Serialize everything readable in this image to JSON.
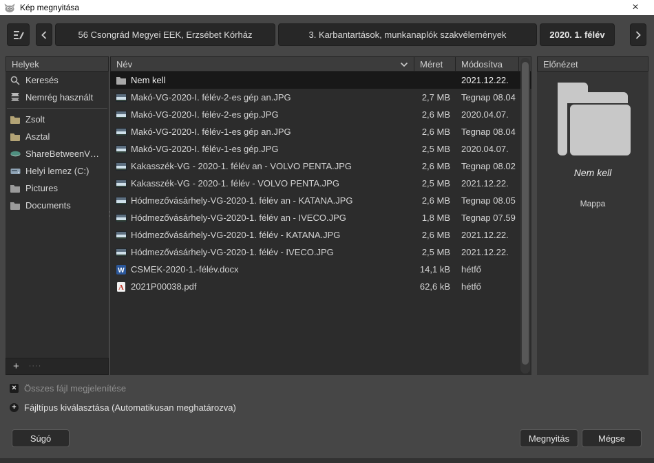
{
  "window": {
    "title": "Kép megnyitása",
    "close_glyph": "×"
  },
  "toolbar": {
    "edit_icon": "edit-filename-icon",
    "back_icon": "chevron-left-icon",
    "forward_icon": "chevron-right-icon",
    "breadcrumbs": [
      {
        "label": "56 Csongrád Megyei EEK, Erzsébet Kórház",
        "current": false
      },
      {
        "label": "3. Karbantartások, munkanaplók szakvélemények",
        "current": false
      },
      {
        "label": "2020. 1. félév",
        "current": true
      }
    ]
  },
  "places": {
    "header": "Helyek",
    "items": [
      {
        "label": "Keresés",
        "icon": "search-icon"
      },
      {
        "label": "Nemrég használt",
        "icon": "recent-icon"
      },
      {
        "label": "Zsolt",
        "icon": "folder-home-icon"
      },
      {
        "label": "Asztal",
        "icon": "folder-desktop-icon"
      },
      {
        "label": "ShareBetweenV…",
        "icon": "network-drive-icon"
      },
      {
        "label": "Helyi lemez (C:)",
        "icon": "drive-icon"
      },
      {
        "label": "Pictures",
        "icon": "folder-gray-icon"
      },
      {
        "label": "Documents",
        "icon": "folder-gray-icon"
      }
    ],
    "add_glyph": "+",
    "remove_glyph": "····"
  },
  "filelist": {
    "columns": {
      "name": "Név",
      "size": "Méret",
      "modified": "Módosítva"
    },
    "rows": [
      {
        "name": "Nem kell",
        "size": "",
        "modified": "2021.12.22.",
        "type": "folder",
        "selected": true
      },
      {
        "name": "Makó-VG-2020-I. félév-2-es gép an.JPG",
        "size": "2,7 MB",
        "modified": "Tegnap 08.04",
        "type": "image",
        "selected": false
      },
      {
        "name": "Makó-VG-2020-I. félév-2-es gép.JPG",
        "size": "2,6 MB",
        "modified": "2020.04.07.",
        "type": "image",
        "selected": false
      },
      {
        "name": "Makó-VG-2020-I. félév-1-es gép an.JPG",
        "size": "2,6 MB",
        "modified": "Tegnap 08.04",
        "type": "image",
        "selected": false
      },
      {
        "name": "Makó-VG-2020-I. félév-1-es gép.JPG",
        "size": "2,5 MB",
        "modified": "2020.04.07.",
        "type": "image",
        "selected": false
      },
      {
        "name": "Kakasszék-VG - 2020-1. félév an - VOLVO PENTA.JPG",
        "size": "2,6 MB",
        "modified": "Tegnap 08.02",
        "type": "image",
        "selected": false
      },
      {
        "name": "Kakasszék-VG - 2020-1. félév - VOLVO PENTA.JPG",
        "size": "2,5 MB",
        "modified": "2021.12.22.",
        "type": "image",
        "selected": false
      },
      {
        "name": "Hódmezővásárhely-VG-2020-1. félév an - KATANA.JPG",
        "size": "2,6 MB",
        "modified": "Tegnap 08.05",
        "type": "image",
        "selected": false
      },
      {
        "name": "Hódmezővásárhely-VG-2020-1. félév an - IVECO.JPG",
        "size": "1,8 MB",
        "modified": "Tegnap 07.59",
        "type": "image",
        "selected": false
      },
      {
        "name": "Hódmezővásárhely-VG-2020-1. félév - KATANA.JPG",
        "size": "2,6 MB",
        "modified": "2021.12.22.",
        "type": "image",
        "selected": false
      },
      {
        "name": "Hódmezővásárhely-VG-2020-1. félév - IVECO.JPG",
        "size": "2,5 MB",
        "modified": "2021.12.22.",
        "type": "image",
        "selected": false
      },
      {
        "name": "CSMEK-2020-1.-félév.docx",
        "size": "14,1 kB",
        "modified": "hétfő",
        "type": "word",
        "selected": false
      },
      {
        "name": "2021P00038.pdf",
        "size": "62,6 kB",
        "modified": "hétfő",
        "type": "pdf",
        "selected": false
      }
    ]
  },
  "preview": {
    "header": "Előnézet",
    "name": "Nem kell",
    "kind": "Mappa"
  },
  "options": {
    "show_all_files": "Összes fájl megjelenítése",
    "show_all_files_checked": "×",
    "file_type": "Fájltípus kiválasztása (Automatikusan meghatározva)",
    "file_type_glyph": "+"
  },
  "actions": {
    "help": "Súgó",
    "open": "Megnyitás",
    "cancel": "Mégse"
  },
  "colors": {
    "titlebar_bg": "#ffffff",
    "dialog_bg": "#464646",
    "list_bg": "#2c2c2c",
    "selected_row_bg": "#181818",
    "button_bg": "#272727",
    "folder_accent": "#b4a476",
    "word_blue": "#2b579a",
    "pdf_red": "#c0392b"
  }
}
